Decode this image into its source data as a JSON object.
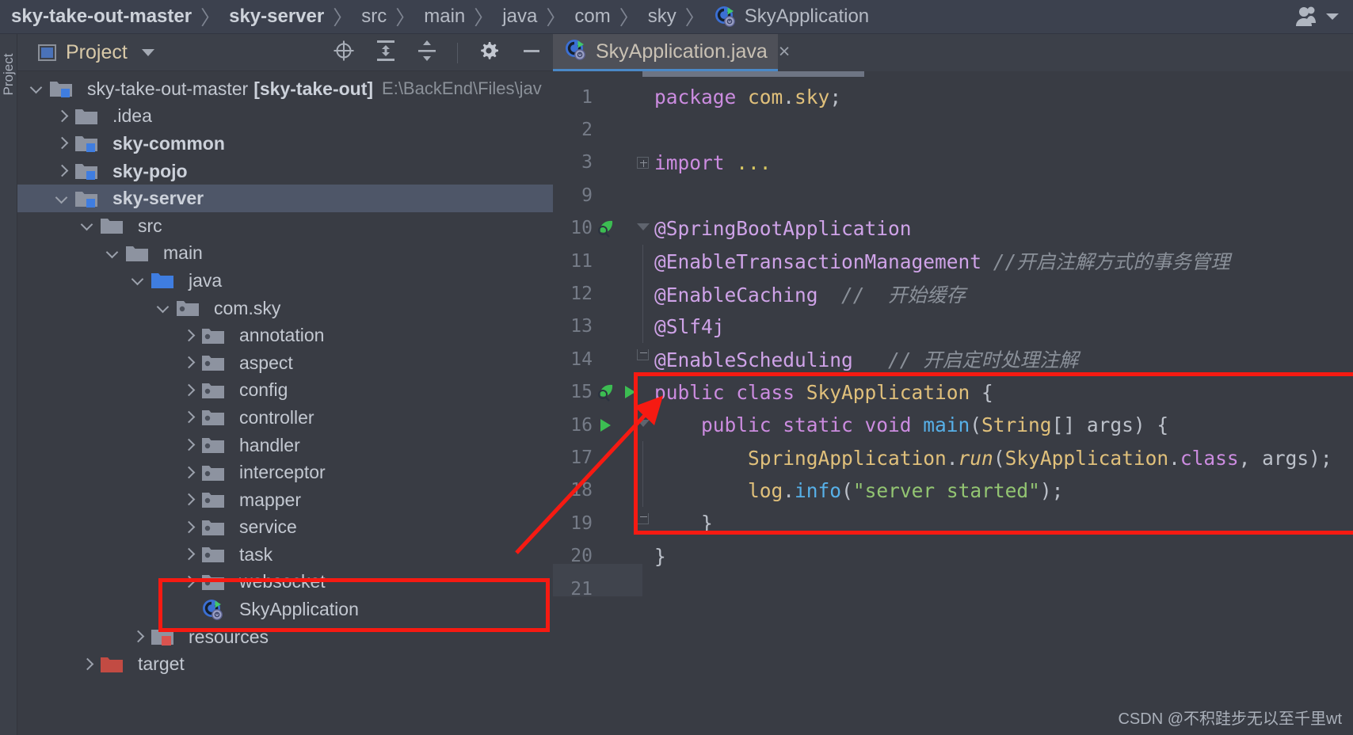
{
  "breadcrumb": {
    "items": [
      {
        "label": "sky-take-out-master",
        "bold": true
      },
      {
        "label": "sky-server",
        "bold": true
      },
      {
        "label": "src",
        "bold": false
      },
      {
        "label": "main",
        "bold": false
      },
      {
        "label": "java",
        "bold": false
      },
      {
        "label": "com",
        "bold": false
      },
      {
        "label": "sky",
        "bold": false
      },
      {
        "label": "SkyApplication",
        "bold": false
      }
    ],
    "separator": "〉"
  },
  "toolwindow_strip": {
    "label": "Project"
  },
  "project_panel": {
    "title": "Project",
    "toolbar_icons": [
      "select-opened-file-icon",
      "expand-all-icon",
      "collapse-all-icon",
      "settings-gear-icon",
      "hide-panel-icon"
    ]
  },
  "tree": {
    "items": [
      {
        "label": "sky-take-out-master",
        "module": "[sky-take-out]",
        "path": "E:\\BackEnd\\Files\\jav",
        "indent": 0,
        "arrow": "down",
        "icon": "module-folder",
        "bold": false,
        "selected": false
      },
      {
        "label": ".idea",
        "indent": 1,
        "arrow": "right",
        "icon": "folder",
        "bold": false,
        "selected": false
      },
      {
        "label": "sky-common",
        "indent": 1,
        "arrow": "right",
        "icon": "module-folder",
        "bold": true,
        "selected": false
      },
      {
        "label": "sky-pojo",
        "indent": 1,
        "arrow": "right",
        "icon": "module-folder",
        "bold": true,
        "selected": false
      },
      {
        "label": "sky-server",
        "indent": 1,
        "arrow": "down",
        "icon": "module-folder",
        "bold": true,
        "selected": true
      },
      {
        "label": "src",
        "indent": 2,
        "arrow": "down",
        "icon": "folder",
        "bold": false,
        "selected": false
      },
      {
        "label": "main",
        "indent": 3,
        "arrow": "down",
        "icon": "folder",
        "bold": false,
        "selected": false
      },
      {
        "label": "java",
        "indent": 4,
        "arrow": "down",
        "icon": "source-folder",
        "bold": false,
        "selected": false
      },
      {
        "label": "com.sky",
        "indent": 5,
        "arrow": "down",
        "icon": "package",
        "bold": false,
        "selected": false
      },
      {
        "label": "annotation",
        "indent": 6,
        "arrow": "right",
        "icon": "package",
        "bold": false,
        "selected": false
      },
      {
        "label": "aspect",
        "indent": 6,
        "arrow": "right",
        "icon": "package",
        "bold": false,
        "selected": false
      },
      {
        "label": "config",
        "indent": 6,
        "arrow": "right",
        "icon": "package",
        "bold": false,
        "selected": false
      },
      {
        "label": "controller",
        "indent": 6,
        "arrow": "right",
        "icon": "package",
        "bold": false,
        "selected": false
      },
      {
        "label": "handler",
        "indent": 6,
        "arrow": "right",
        "icon": "package",
        "bold": false,
        "selected": false
      },
      {
        "label": "interceptor",
        "indent": 6,
        "arrow": "right",
        "icon": "package",
        "bold": false,
        "selected": false
      },
      {
        "label": "mapper",
        "indent": 6,
        "arrow": "right",
        "icon": "package",
        "bold": false,
        "selected": false
      },
      {
        "label": "service",
        "indent": 6,
        "arrow": "right",
        "icon": "package",
        "bold": false,
        "selected": false
      },
      {
        "label": "task",
        "indent": 6,
        "arrow": "right",
        "icon": "package",
        "bold": false,
        "selected": false
      },
      {
        "label": "websocket",
        "indent": 6,
        "arrow": "right",
        "icon": "package",
        "bold": false,
        "selected": false
      },
      {
        "label": "SkyApplication",
        "indent": 6,
        "arrow": "none",
        "icon": "spring-boot-class",
        "bold": false,
        "selected": false
      },
      {
        "label": "resources",
        "indent": 4,
        "arrow": "right",
        "icon": "resources-folder",
        "bold": false,
        "selected": false
      },
      {
        "label": "target",
        "indent": 2,
        "arrow": "right",
        "icon": "target-folder",
        "bold": false,
        "selected": false
      }
    ]
  },
  "editor": {
    "tab": {
      "title": "SkyApplication.java",
      "icon": "spring-boot-class",
      "close": "×"
    },
    "lines": [
      {
        "num": "1",
        "fold": "none",
        "gutter": [],
        "segments": [
          {
            "t": "package ",
            "c": "kw"
          },
          {
            "t": "com",
            "c": "typ"
          },
          {
            "t": ".",
            "c": "plain"
          },
          {
            "t": "sky",
            "c": "typ"
          },
          {
            "t": ";",
            "c": "plain"
          }
        ]
      },
      {
        "num": "2",
        "fold": "none",
        "gutter": [],
        "segments": []
      },
      {
        "num": "3",
        "fold": "plus",
        "gutter": [],
        "segments": [
          {
            "t": "import ",
            "c": "kw"
          },
          {
            "t": "...",
            "c": "fold-dots"
          }
        ]
      },
      {
        "num": "9",
        "fold": "none",
        "gutter": [],
        "segments": []
      },
      {
        "num": "10",
        "fold": "minus-top",
        "gutter": [
          "spring-bean-icon"
        ],
        "segments": [
          {
            "t": "@SpringBootApplication",
            "c": "anno"
          }
        ]
      },
      {
        "num": "11",
        "fold": "line",
        "gutter": [],
        "segments": [
          {
            "t": "@EnableTransactionManagement",
            "c": "anno"
          },
          {
            "t": " ",
            "c": "plain"
          },
          {
            "t": "//开启注解方式的事务管理",
            "c": "cmt"
          }
        ]
      },
      {
        "num": "12",
        "fold": "line",
        "gutter": [],
        "segments": [
          {
            "t": "@EnableCaching",
            "c": "anno"
          },
          {
            "t": "  ",
            "c": "plain"
          },
          {
            "t": "//  开始缓存",
            "c": "cmt"
          }
        ]
      },
      {
        "num": "13",
        "fold": "line",
        "gutter": [],
        "segments": [
          {
            "t": "@Slf4j",
            "c": "anno"
          }
        ]
      },
      {
        "num": "14",
        "fold": "end",
        "gutter": [],
        "segments": [
          {
            "t": "@EnableScheduling",
            "c": "anno"
          },
          {
            "t": "   ",
            "c": "plain"
          },
          {
            "t": "// 开启定时处理注解",
            "c": "cmt"
          }
        ]
      },
      {
        "num": "15",
        "fold": "none",
        "gutter": [
          "spring-bean-icon",
          "run-icon"
        ],
        "segments": [
          {
            "t": "public class ",
            "c": "kw"
          },
          {
            "t": "SkyApplication",
            "c": "typ"
          },
          {
            "t": " {",
            "c": "plain"
          }
        ]
      },
      {
        "num": "16",
        "fold": "minus-top",
        "gutter": [
          "run-icon"
        ],
        "segments": [
          {
            "t": "    public static void ",
            "c": "kw"
          },
          {
            "t": "main",
            "c": "fn"
          },
          {
            "t": "(",
            "c": "plain"
          },
          {
            "t": "String",
            "c": "typ"
          },
          {
            "t": "[] args) {",
            "c": "plain"
          }
        ]
      },
      {
        "num": "17",
        "fold": "line",
        "gutter": [],
        "segments": [
          {
            "t": "        ",
            "c": "plain"
          },
          {
            "t": "SpringApplication",
            "c": "typ"
          },
          {
            "t": ".",
            "c": "plain"
          },
          {
            "t": "run",
            "c": "fni"
          },
          {
            "t": "(",
            "c": "plain"
          },
          {
            "t": "SkyApplication",
            "c": "typ"
          },
          {
            "t": ".",
            "c": "plain"
          },
          {
            "t": "class",
            "c": "kw"
          },
          {
            "t": ", args);",
            "c": "plain"
          }
        ]
      },
      {
        "num": "18",
        "fold": "line",
        "gutter": [],
        "segments": [
          {
            "t": "        ",
            "c": "plain"
          },
          {
            "t": "log",
            "c": "typ"
          },
          {
            "t": ".",
            "c": "plain"
          },
          {
            "t": "info",
            "c": "fn"
          },
          {
            "t": "(",
            "c": "plain"
          },
          {
            "t": "\"server started\"",
            "c": "str"
          },
          {
            "t": ");",
            "c": "plain"
          }
        ]
      },
      {
        "num": "19",
        "fold": "end",
        "gutter": [],
        "segments": [
          {
            "t": "    }",
            "c": "plain"
          }
        ]
      },
      {
        "num": "20",
        "fold": "none",
        "gutter": [],
        "segments": [
          {
            "t": "}",
            "c": "plain"
          }
        ]
      },
      {
        "num": "21",
        "fold": "none",
        "gutter": [],
        "segments": []
      }
    ]
  },
  "annotations": {
    "highlight_color": "#f61a12",
    "code_box_target": "public class SkyApplication block",
    "tree_box_target": "SkyApplication tree node"
  },
  "watermark": {
    "text": "CSDN @不积跬步无以至千里wt"
  }
}
